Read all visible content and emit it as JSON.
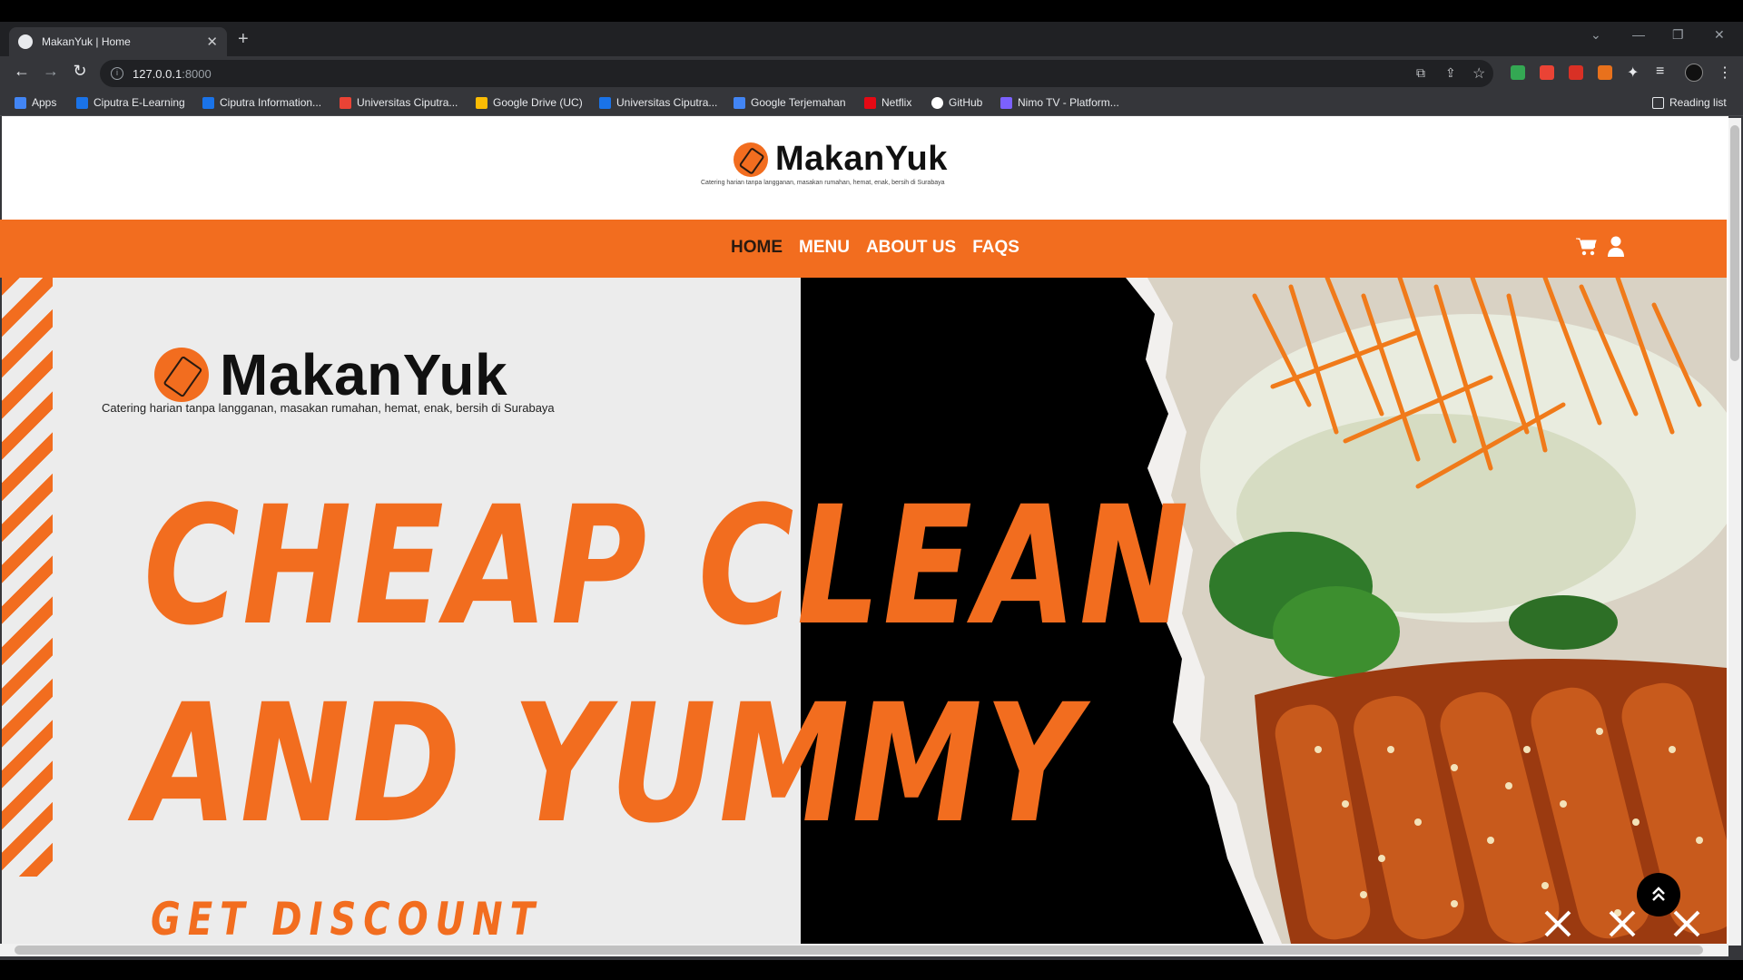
{
  "browser": {
    "tab_title": "MakanYuk | Home",
    "url_host": "127.0.0.1",
    "url_port": ":8000",
    "bookmarks": [
      {
        "label": "Apps",
        "color": "#4285f4"
      },
      {
        "label": "Ciputra E-Learning",
        "color": "#1a73e8"
      },
      {
        "label": "Ciputra Information...",
        "color": "#1a73e8"
      },
      {
        "label": "Universitas Ciputra...",
        "color": "#ea4335"
      },
      {
        "label": "Google Drive (UC)",
        "color": "#fbbc04"
      },
      {
        "label": "Universitas Ciputra...",
        "color": "#1a73e8"
      },
      {
        "label": "Google Terjemahan",
        "color": "#4285f4"
      },
      {
        "label": "Netflix",
        "color": "#e50914"
      },
      {
        "label": "GitHub",
        "color": "#ffffff"
      },
      {
        "label": "Nimo TV - Platform...",
        "color": "#7b61ff"
      }
    ],
    "reading_list": "Reading list"
  },
  "site": {
    "brand": "MakanYuk",
    "tagline": "Catering harian  tanpa langganan, masakan rumahan, hemat, enak, bersih di Surabaya",
    "nav": [
      "HOME",
      "MENU",
      "ABOUT US",
      "FAQS"
    ],
    "active_nav": "HOME",
    "accent_color": "#f26d1f"
  },
  "hero": {
    "line1": "CHEAP CLEAN",
    "line2": "AND YUMMY",
    "cta": "GET DISCOUNT"
  },
  "icons": {
    "cart": "cart-icon",
    "user": "user-icon",
    "scroll_top": "double-chevron-up-icon",
    "close": "close-icon"
  }
}
